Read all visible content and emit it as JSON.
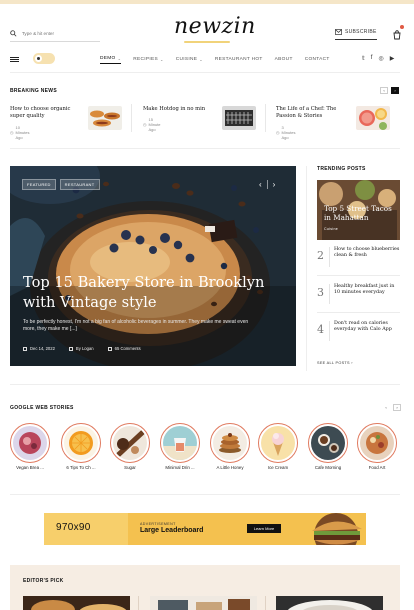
{
  "header": {
    "search_placeholder": "Type & hit enter",
    "logo": "newzin",
    "subscribe_label": "Subscribe"
  },
  "nav": {
    "items": [
      {
        "label": "Demo",
        "has_dropdown": true
      },
      {
        "label": "Recipies",
        "has_dropdown": true
      },
      {
        "label": "Cuisine",
        "has_dropdown": true
      },
      {
        "label": "Restaurant Hot",
        "has_dropdown": false
      },
      {
        "label": "About",
        "has_dropdown": false
      },
      {
        "label": "Contact",
        "has_dropdown": false
      }
    ],
    "socials": [
      "twitter-icon",
      "facebook-icon",
      "instagram-icon",
      "youtube-icon"
    ]
  },
  "breaking": {
    "title": "Breaking News",
    "items": [
      {
        "title": "How to choose organic super quality",
        "ago": "10 Minutes Ago"
      },
      {
        "title": "Make Hotdog in no min",
        "ago": "15 Minute Ago"
      },
      {
        "title": "The Life of a Chef: The Passion & Stories",
        "ago": "3 Minutes Ago"
      }
    ]
  },
  "hero": {
    "tags": [
      "Featured",
      "Restaurant"
    ],
    "title": "Top 15 Bakery Store in Brooklyn with Vintage style",
    "excerpt": "To be perfectly honest, I'm not a big fan of alcoholic beverages in summer. They make me sweat even more, they make me [...]",
    "date": "Dec 14, 2022",
    "author": "By Logan",
    "comments": "65 Comments"
  },
  "trending": {
    "title": "Trending Posts",
    "main": {
      "title": "Top 5 Street Tacos in Mahattan",
      "category": "Cuisine"
    },
    "items": [
      {
        "num": "2",
        "title": "How to choose blueberries clean & fresh"
      },
      {
        "num": "3",
        "title": "Healthy breakfast just in 10 minutes everyday"
      },
      {
        "num": "4",
        "title": "Don't read on calories everyday with Calo App"
      }
    ],
    "see_all": "See All Posts"
  },
  "stories": {
    "title": "Google Web Stories",
    "items": [
      {
        "label": "Vegan Brea ..."
      },
      {
        "label": "6 Tips To Ch ..."
      },
      {
        "label": "Sugar"
      },
      {
        "label": "Minimal Drin ..."
      },
      {
        "label": "A Little Honey"
      },
      {
        "label": "Ice Cream"
      },
      {
        "label": "Cafe Morning"
      },
      {
        "label": "Food Art"
      }
    ]
  },
  "ad": {
    "size": "970x90",
    "small": "Advertisement",
    "big": "Large Leaderboard",
    "button": "Learn More"
  },
  "editors_pick": {
    "title": "Editor's Pick"
  },
  "colors": {
    "accent": "#f4c14f",
    "ring": "#e07a5f",
    "hero_bg": "#1e2b35"
  }
}
